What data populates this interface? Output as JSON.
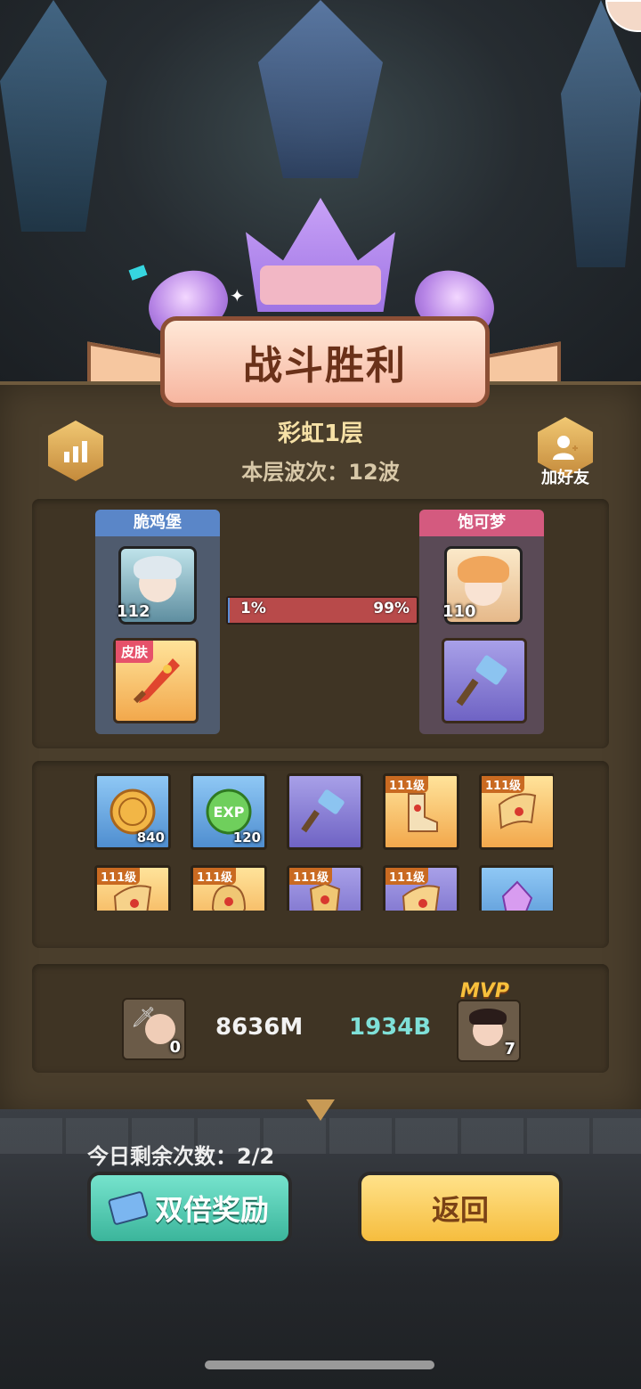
{
  "banner": {
    "title": "战斗胜利"
  },
  "stage": {
    "floor": "彩虹1层",
    "waves_label": "本层波次：12波"
  },
  "top_right": {
    "add_friend_label": "加好友"
  },
  "teams": {
    "left": {
      "name": "脆鸡堡",
      "level": "112",
      "item_tag": "皮肤",
      "color": "#5a86c8"
    },
    "right": {
      "name": "饱可梦",
      "level": "110",
      "color": "#d45a7f"
    }
  },
  "progress": {
    "left_pct_label": "1%",
    "right_pct_label": "99%",
    "left_fraction": 0.01
  },
  "rewards": [
    {
      "kind": "coin",
      "bg": "blue",
      "count": "840",
      "badge": ""
    },
    {
      "kind": "exp",
      "bg": "blue",
      "count": "120",
      "badge": ""
    },
    {
      "kind": "hammer",
      "bg": "purple",
      "count": "",
      "badge": ""
    },
    {
      "kind": "boots",
      "bg": "gold",
      "count": "",
      "badge": "111级"
    },
    {
      "kind": "horn",
      "bg": "gold",
      "count": "",
      "badge": "111级"
    },
    {
      "kind": "horn",
      "bg": "gold",
      "count": "",
      "badge": "111级"
    },
    {
      "kind": "helmet",
      "bg": "gold",
      "count": "",
      "badge": "111级"
    },
    {
      "kind": "armor",
      "bg": "purple",
      "count": "",
      "badge": "111级"
    },
    {
      "kind": "horn",
      "bg": "purple",
      "count": "",
      "badge": "111级"
    },
    {
      "kind": "crystal",
      "bg": "blue",
      "count": "",
      "badge": ""
    }
  ],
  "stats": {
    "left_count": "0",
    "left_damage": "8636M",
    "right_damage": "1934B",
    "mvp_label": "MVP",
    "right_count": "7",
    "left_color": "#f2f2f2",
    "right_color": "#7fe0d8"
  },
  "footer": {
    "remaining": "今日剩余次数：2/2",
    "double_reward": "双倍奖励",
    "back": "返回"
  }
}
